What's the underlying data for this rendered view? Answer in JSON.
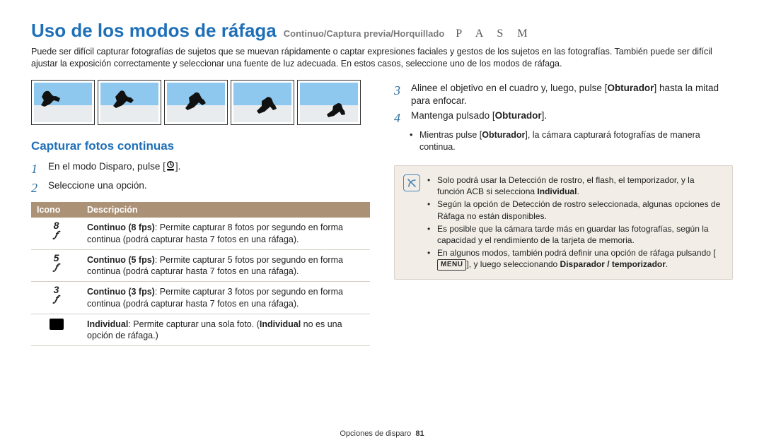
{
  "header": {
    "title": "Uso de los modos de ráfaga",
    "subtitle": "Continuo/Captura previa/Horquillado",
    "pasm": "P A S M"
  },
  "intro": "Puede ser difícil capturar fotografías de sujetos que se muevan rápidamente o captar expresiones faciales y gestos de los sujetos en las fotografías. También puede ser difícil ajustar la exposición correctamente y seleccionar una fuente de luz adecuada. En estos casos, seleccione uno de los modos de ráfaga.",
  "left": {
    "section_title": "Capturar fotos continuas",
    "step1_a": "En el modo Disparo, pulse [",
    "step1_b": "].",
    "step2": "Seleccione una opción.",
    "table": {
      "h_icon": "Icono",
      "h_desc": "Descripción",
      "rows": [
        {
          "icon_type": "burst",
          "icon_num": "8",
          "b": "Continuo (8 fps)",
          "rest": ": Permite capturar 8 fotos por segundo en forma continua (podrá capturar hasta 7 fotos en una ráfaga)."
        },
        {
          "icon_type": "burst",
          "icon_num": "5",
          "b": "Continuo (5 fps)",
          "rest": ": Permite capturar 5 fotos por segundo en forma continua (podrá capturar hasta 7 fotos en una ráfaga)."
        },
        {
          "icon_type": "burst",
          "icon_num": "3",
          "b": "Continuo (3 fps)",
          "rest": ": Permite capturar 3 fotos por segundo en forma continua (podrá capturar hasta 7 fotos en una ráfaga)."
        },
        {
          "icon_type": "single",
          "icon_num": "",
          "b": "Individual",
          "rest": ": Permite capturar una sola foto. (",
          "b2": "Individual",
          "rest2": " no es una opción de ráfaga.)"
        }
      ]
    }
  },
  "right": {
    "step3_a": "Alinee el objetivo en el cuadro y, luego, pulse [",
    "step3_b": "Obturador",
    "step3_c": "] hasta la mitad para enfocar.",
    "step4_a": "Mantenga pulsado [",
    "step4_b": "Obturador",
    "step4_c": "].",
    "step4_sub_a": "Mientras pulse [",
    "step4_sub_b": "Obturador",
    "step4_sub_c": "], la cámara capturará fotografías de manera continua.",
    "notes": {
      "n1_a": "Solo podrá usar la Detección de rostro, el flash, el temporizador, y la función ACB si selecciona ",
      "n1_b": "Individual",
      "n1_c": ".",
      "n2": "Según la opción de Detección de rostro seleccionada, algunas opciones de Ráfaga no están disponibles.",
      "n3": "Es posible que la cámara tarde más en guardar las fotografías, según la capacidad y el rendimiento de la tarjeta de memoria.",
      "n4_a": "En algunos modos, también podrá definir una opción de ráfaga pulsando [",
      "n4_menu": "MENU",
      "n4_b": "], y luego seleccionando ",
      "n4_c": "Disparador / temporizador",
      "n4_d": "."
    }
  },
  "footer": {
    "section": "Opciones de disparo",
    "page": "81"
  }
}
